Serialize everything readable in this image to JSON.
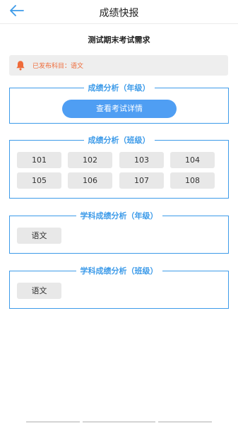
{
  "header": {
    "title": "成绩快报",
    "back_icon": "arrow-left-icon",
    "accent": "#3d9be9"
  },
  "exam": {
    "title": "测试期末考试需求"
  },
  "notice": {
    "icon": "bell-icon",
    "text": "已发布科目：语文",
    "color": "#ef6b3a"
  },
  "sections": {
    "grade_analysis": {
      "title": "成绩分析（年级）",
      "button_label": "查看考试详情"
    },
    "class_analysis": {
      "title": "成绩分析（班级）",
      "classes": [
        "101",
        "102",
        "103",
        "104",
        "105",
        "106",
        "107",
        "108"
      ]
    },
    "subject_grade": {
      "title": "学科成绩分析（年级）",
      "subjects": [
        "语文"
      ]
    },
    "subject_class": {
      "title": "学科成绩分析（班级）",
      "subjects": [
        "语文"
      ]
    }
  }
}
